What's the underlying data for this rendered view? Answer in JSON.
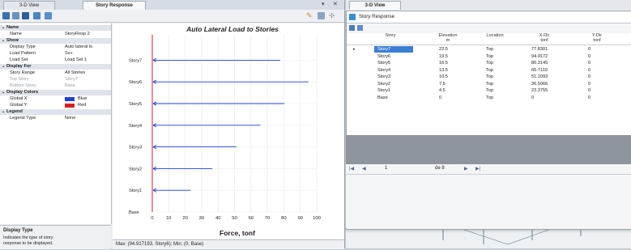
{
  "left_pane": {
    "tabs": [
      "3-D View",
      "Story Response"
    ],
    "controls": {
      "pin": "▾",
      "close": "✕"
    }
  },
  "properties": [
    {
      "type": "cat",
      "label": "Name"
    },
    {
      "type": "row",
      "label": "Name",
      "value": "StoryResp 2"
    },
    {
      "type": "cat",
      "label": "Show"
    },
    {
      "type": "row",
      "label": "Display Type",
      "value": "Auto lateral lo"
    },
    {
      "type": "row",
      "label": "Load Pattern",
      "value": "Sx+"
    },
    {
      "type": "row",
      "label": "Load Set",
      "value": "Load Set 1"
    },
    {
      "type": "cat",
      "label": "Display For"
    },
    {
      "type": "row",
      "label": "Story Range",
      "value": "All Stories"
    },
    {
      "type": "dim",
      "label": "Top Story",
      "value": "Story7"
    },
    {
      "type": "dim",
      "label": "Bottom Story",
      "value": "Base"
    },
    {
      "type": "cat",
      "label": "Display Colors"
    },
    {
      "type": "color",
      "label": "Global X",
      "value": "Blue",
      "color": "#1f3fd6"
    },
    {
      "type": "color",
      "label": "Global Y",
      "value": "Red",
      "color": "#d62020"
    },
    {
      "type": "cat",
      "label": "Legend"
    },
    {
      "type": "row",
      "label": "Legend Type",
      "value": "None"
    }
  ],
  "help": {
    "title": "Display Type",
    "text_1": "Indicates the type of story",
    "text_2": "response to be displayed."
  },
  "chart_data": {
    "type": "bar",
    "title": "Auto Lateral Load to Stories",
    "xlabel": "Force, tonf",
    "ylabel": "",
    "categories": [
      "Base",
      "Story1",
      "Story2",
      "Story3",
      "Story4",
      "Story5",
      "Story6",
      "Story7"
    ],
    "values": [
      0,
      23.3755,
      36.5066,
      51.1093,
      65.7119,
      80.3145,
      94.9172,
      77.8301
    ],
    "xlim": [
      0,
      100
    ],
    "xticks": [
      0,
      10,
      20,
      30,
      40,
      50,
      60,
      70,
      80,
      90,
      100
    ],
    "color": "#1f3fd6",
    "status": "Max: (94.917193, Story6);  Min: (0; Base)"
  },
  "right_pane": {
    "tab": "3-D View",
    "window_title": "Story Response",
    "columns": [
      {
        "l1": "Story",
        "l2": ""
      },
      {
        "l1": "Elevation",
        "l2": "m"
      },
      {
        "l1": "Location",
        "l2": ""
      },
      {
        "l1": "X-Dir",
        "l2": "tonf"
      },
      {
        "l1": "Y-Dir",
        "l2": "tonf"
      }
    ],
    "rows": [
      [
        "Story7",
        "22.5",
        "Top",
        "77.8301",
        "0"
      ],
      [
        "Story6",
        "19.5",
        "Top",
        "94.9172",
        "0"
      ],
      [
        "Story5",
        "16.5",
        "Top",
        "80.3145",
        "0"
      ],
      [
        "Story4",
        "13.5",
        "Top",
        "65.7119",
        "0"
      ],
      [
        "Story3",
        "10.5",
        "Top",
        "51.1093",
        "0"
      ],
      [
        "Story2",
        "7.5",
        "Top",
        "36.5066",
        "0"
      ],
      [
        "Story1",
        "4.5",
        "Top",
        "23.3755",
        "0"
      ],
      [
        "Base",
        "0",
        "Top",
        "0",
        "0"
      ]
    ],
    "pager": {
      "current": "1",
      "of": "de 8"
    }
  }
}
